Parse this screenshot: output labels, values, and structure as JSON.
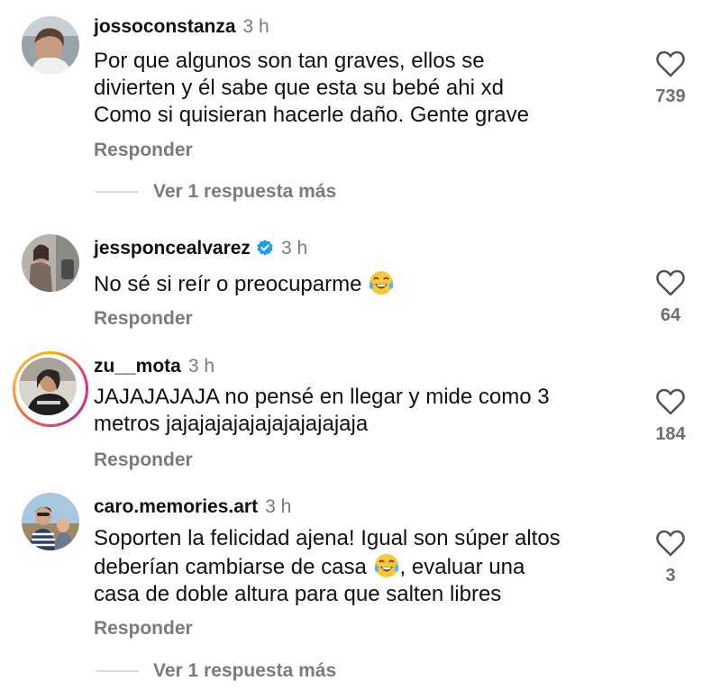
{
  "comments": [
    {
      "username": "jossoconstanza",
      "time": "3 h",
      "verified": false,
      "lines": [
        "Por que algunos son tan graves, ellos se",
        "divierten y él sabe que esta su bebé ahi xd",
        "Como si quisieran hacerle daño. Gente grave"
      ],
      "likes": "739",
      "reply_label": "Responder",
      "more_replies": "Ver 1 respuesta más"
    },
    {
      "username": "jessponcealvarez",
      "time": "3 h",
      "verified": true,
      "lines": [
        "No sé si reír o preocuparme"
      ],
      "emoji": "face-with-tears-of-joy",
      "likes": "64",
      "reply_label": "Responder"
    },
    {
      "username": "zu__mota",
      "time": "3 h",
      "verified": false,
      "has_story": true,
      "lines": [
        "JAJAJAJAJA no pensé en llegar y mide como 3",
        "metros jajajajajajajajajajajaja"
      ],
      "likes": "184",
      "reply_label": "Responder"
    },
    {
      "username": "caro.memories.art",
      "time": "3 h",
      "verified": false,
      "lines": [
        "Soporten la felicidad ajena! Igual son súper altos",
        "deberían cambiarse de casa",
        ", evaluar una",
        "casa de doble altura para que salten libres"
      ],
      "emoji": "face-with-tears-of-joy",
      "likes": "3",
      "reply_label": "Responder",
      "more_replies": "Ver 1 respuesta más"
    }
  ],
  "colors": {
    "text": "#111111",
    "secondary": "#7b7b7b",
    "verified": "#1d9bf0",
    "line": "#dbdbdb"
  }
}
